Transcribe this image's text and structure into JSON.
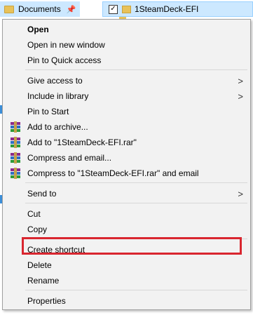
{
  "background": {
    "nav_item_label": "Documents",
    "selected_file_label": "1SteamDeck-EFI",
    "checkbox_mark": "✓"
  },
  "menu": {
    "open": "Open",
    "open_new_window": "Open in new window",
    "pin_quick_access": "Pin to Quick access",
    "give_access_to": "Give access to",
    "include_in_library": "Include in library",
    "pin_to_start": "Pin to Start",
    "add_to_archive": "Add to archive...",
    "add_to_rar": "Add to \"1SteamDeck-EFI.rar\"",
    "compress_and_email": "Compress and email...",
    "compress_to_rar_email": "Compress to \"1SteamDeck-EFI.rar\" and email",
    "send_to": "Send to",
    "cut": "Cut",
    "copy": "Copy",
    "create_shortcut": "Create shortcut",
    "delete": "Delete",
    "rename": "Rename",
    "properties": "Properties",
    "submenu_arrow": ">"
  },
  "colors": {
    "highlight": "#d9262f",
    "menu_bg": "#f2f2f2",
    "selection_bg": "#cce8ff"
  },
  "icons": {
    "winrar": "winrar-icon",
    "pin": "pin-icon",
    "folder": "folder-icon"
  }
}
